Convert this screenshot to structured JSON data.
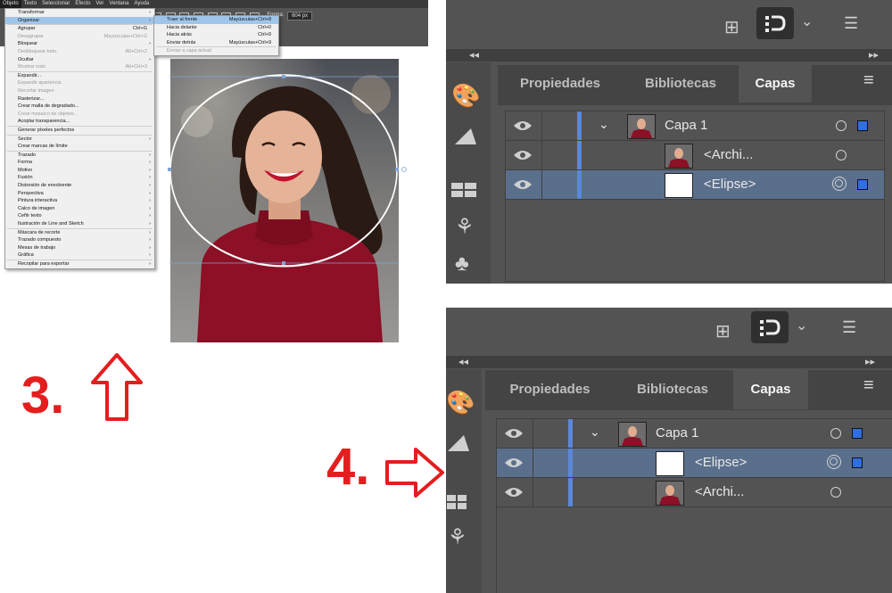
{
  "menubar": {
    "items": [
      "Objeto",
      "Texto",
      "Seleccionar",
      "Efecto",
      "Ver",
      "Ventana",
      "Ayuda"
    ],
    "active": "Objeto"
  },
  "ctrlbar": {
    "field_label": "Forma:",
    "field_value": "604 px"
  },
  "objeto_menu": {
    "items": [
      {
        "label": "Transformar",
        "shortcut": "",
        "sub": true,
        "disabled": false
      },
      {
        "label": "Organizar",
        "shortcut": "",
        "sub": true,
        "disabled": false,
        "highlight": true
      },
      {
        "sep": true
      },
      {
        "label": "Agrupar",
        "shortcut": "Ctrl+G",
        "sub": false,
        "disabled": false
      },
      {
        "label": "Desagrupar",
        "shortcut": "Mayúsculas+Ctrl+G",
        "sub": false,
        "disabled": true
      },
      {
        "label": "Bloquear",
        "shortcut": "",
        "sub": true,
        "disabled": false
      },
      {
        "label": "Desbloquear todo",
        "shortcut": "Alt+Ctrl+2",
        "sub": false,
        "disabled": true
      },
      {
        "label": "Ocultar",
        "shortcut": "",
        "sub": true,
        "disabled": false
      },
      {
        "label": "Mostrar todo",
        "shortcut": "Alt+Ctrl+3",
        "sub": false,
        "disabled": true
      },
      {
        "sep": true
      },
      {
        "label": "Expandir...",
        "shortcut": "",
        "sub": false,
        "disabled": false
      },
      {
        "label": "Expandir apariencia",
        "shortcut": "",
        "sub": false,
        "disabled": true
      },
      {
        "label": "Recortar imagen",
        "shortcut": "",
        "sub": false,
        "disabled": true
      },
      {
        "label": "Rasterizar...",
        "shortcut": "",
        "sub": false,
        "disabled": false
      },
      {
        "label": "Crear malla de degradado...",
        "shortcut": "",
        "sub": false,
        "disabled": false
      },
      {
        "label": "Crear mosaico de objetos...",
        "shortcut": "",
        "sub": false,
        "disabled": true
      },
      {
        "label": "Acoplar transparencia...",
        "shortcut": "",
        "sub": false,
        "disabled": false
      },
      {
        "sep": true
      },
      {
        "label": "Generar píxeles perfectos",
        "shortcut": "",
        "sub": false,
        "disabled": false
      },
      {
        "sep": true
      },
      {
        "label": "Sector",
        "shortcut": "",
        "sub": true,
        "disabled": false
      },
      {
        "label": "Crear marcas de límite",
        "shortcut": "",
        "sub": false,
        "disabled": false
      },
      {
        "sep": true
      },
      {
        "label": "Trazado",
        "shortcut": "",
        "sub": true,
        "disabled": false
      },
      {
        "label": "Forma",
        "shortcut": "",
        "sub": true,
        "disabled": false
      },
      {
        "label": "Motivo",
        "shortcut": "",
        "sub": true,
        "disabled": false
      },
      {
        "label": "Fusión",
        "shortcut": "",
        "sub": true,
        "disabled": false
      },
      {
        "label": "Distorsión de envolvente",
        "shortcut": "",
        "sub": true,
        "disabled": false
      },
      {
        "label": "Perspectiva",
        "shortcut": "",
        "sub": true,
        "disabled": false
      },
      {
        "label": "Pintura interactiva",
        "shortcut": "",
        "sub": true,
        "disabled": false
      },
      {
        "label": "Calco de imagen",
        "shortcut": "",
        "sub": true,
        "disabled": false
      },
      {
        "label": "Ceñir texto",
        "shortcut": "",
        "sub": true,
        "disabled": false
      },
      {
        "label": "Ilustración de Line and Sketch",
        "shortcut": "",
        "sub": true,
        "disabled": false
      },
      {
        "sep": true
      },
      {
        "label": "Máscara de recorte",
        "shortcut": "",
        "sub": true,
        "disabled": false
      },
      {
        "label": "Trazado compuesto",
        "shortcut": "",
        "sub": true,
        "disabled": false
      },
      {
        "label": "Mesas de trabajo",
        "shortcut": "",
        "sub": true,
        "disabled": false
      },
      {
        "label": "Gráfica",
        "shortcut": "",
        "sub": true,
        "disabled": false
      },
      {
        "sep": true
      },
      {
        "label": "Recopilar para exportar",
        "shortcut": "",
        "sub": true,
        "disabled": false
      }
    ]
  },
  "organizar_menu": {
    "items": [
      {
        "label": "Traer al frente",
        "shortcut": "Mayúsculas+Ctrl+8",
        "disabled": false,
        "highlight": true
      },
      {
        "label": "Hacia delante",
        "shortcut": "Ctrl+0",
        "disabled": false
      },
      {
        "label": "Hacia atrás",
        "shortcut": "Ctrl+9",
        "disabled": false
      },
      {
        "label": "Enviar detrás",
        "shortcut": "Mayúsculas+Ctrl+9",
        "disabled": false
      },
      {
        "sep": true
      },
      {
        "label": "Enviar a capa actual",
        "shortcut": "",
        "disabled": true
      }
    ]
  },
  "annotations": {
    "step3": "3.",
    "step4": "4."
  },
  "panels": {
    "tabs": [
      "Propiedades",
      "Bibliotecas",
      "Capas"
    ],
    "active_tab": "Capas",
    "before": [
      {
        "name": "Capa 1",
        "kind": "layer",
        "selected": false
      },
      {
        "name": "<Archi...",
        "kind": "image",
        "selected": false
      },
      {
        "name": "<Elipse>",
        "kind": "ellipse",
        "selected": true
      }
    ],
    "after": [
      {
        "name": "Capa 1",
        "kind": "layer",
        "selected": false
      },
      {
        "name": "<Elipse>",
        "kind": "ellipse",
        "selected": true
      },
      {
        "name": "<Archi...",
        "kind": "image",
        "selected": false
      }
    ]
  },
  "colors": {
    "accent_red": "#e41e1e",
    "layer_blue": "#5a87d8",
    "selection_row": "#5a6f8c",
    "menu_highlight": "#9fc6ea"
  }
}
